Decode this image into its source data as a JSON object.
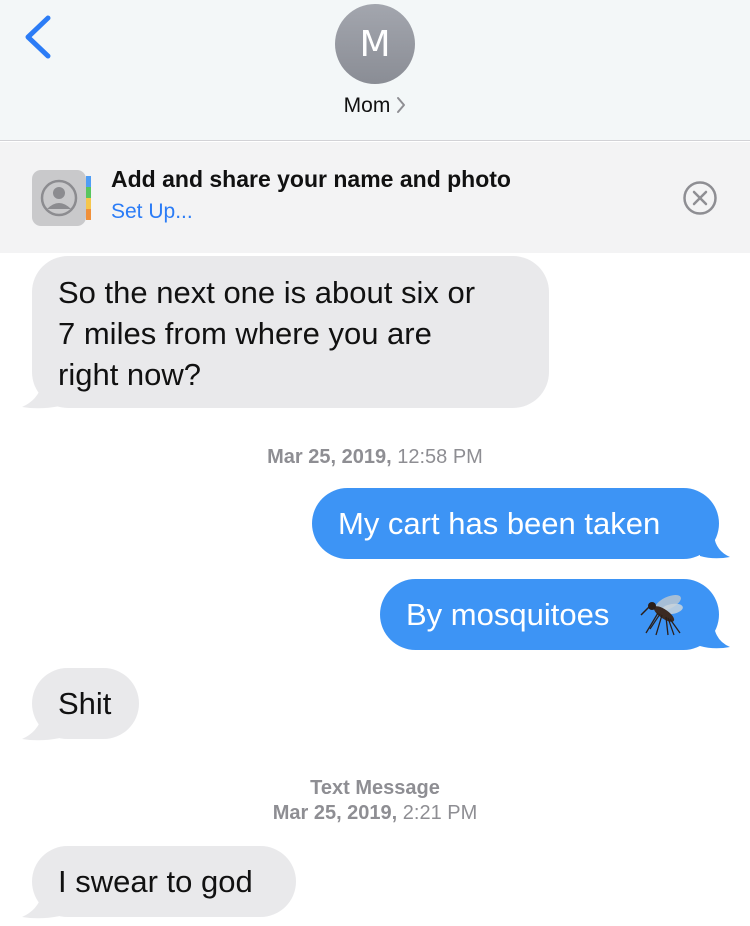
{
  "header": {
    "avatar_initial": "M",
    "contact_name": "Mom"
  },
  "banner": {
    "title": "Add and share your name and photo",
    "link": "Set Up..."
  },
  "messages": [
    {
      "side": "in",
      "line1": "So the next one is about six or",
      "line2": "7 miles from where you are",
      "line3": "right now?"
    },
    {
      "side": "out",
      "text": "My cart has been taken"
    },
    {
      "side": "out",
      "text": "By mosquitoes"
    },
    {
      "side": "in",
      "text": "Shit"
    },
    {
      "side": "in",
      "text": "I swear to god"
    }
  ],
  "timestamps": {
    "first_date": "Mar 25, 2019,",
    "first_time": "12:58 PM",
    "service": "Text Message",
    "second_date": "Mar 25, 2019,",
    "second_time": "2:21 PM"
  },
  "colors": {
    "accent": "#2b7cf6",
    "outgoing_bubble": "#3d94f5",
    "incoming_bubble": "#e9e9eb"
  }
}
